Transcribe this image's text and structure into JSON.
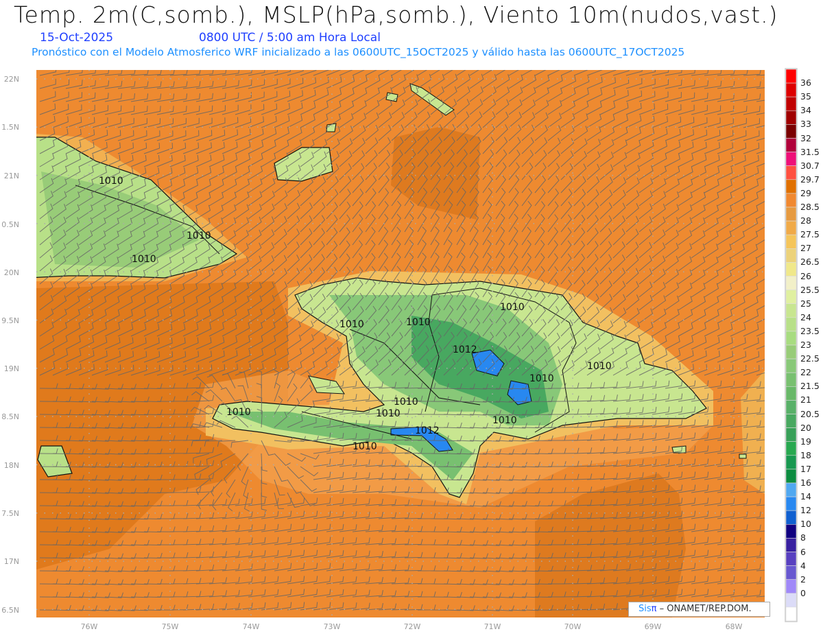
{
  "header": {
    "title": "Temp. 2m(C,somb.), MSLP(hPa,somb.), Viento 10m(nudos,vast.)",
    "date": "15-Oct-2025",
    "time": "0800 UTC / 5:00 am Hora Local",
    "description": "Pronóstico con el Modelo Atmosferico WRF inicializado a las 0600UTC_15OCT2025 y válido hasta las  0600UTC_17OCT2025"
  },
  "axes": {
    "x_labels": [
      "76W",
      "75W",
      "74W",
      "73W",
      "72W",
      "71W",
      "70W",
      "69W",
      "68W"
    ],
    "y_labels": [
      "22N",
      "1.5N",
      "21N",
      "0.5N",
      "20N",
      "9.5N",
      "19N",
      "8.5N",
      "18N",
      "7.5N",
      "17N",
      "6.5N"
    ]
  },
  "contour_labels": [
    "1010",
    "1010",
    "1010",
    "1010",
    "1010",
    "1010",
    "1010",
    "1012",
    "1010",
    "1010",
    "1010",
    "1010",
    "1010",
    "1012",
    "1010"
  ],
  "colorbar": {
    "labels": [
      "36",
      "35",
      "34",
      "33",
      "32",
      "31.5",
      "30.7",
      "29.7",
      "29",
      "28.5",
      "28",
      "27.5",
      "27",
      "26.5",
      "26",
      "25.5",
      "25",
      "24",
      "23.5",
      "23",
      "22.5",
      "22",
      "21.5",
      "21",
      "20.5",
      "20",
      "19",
      "18",
      "17",
      "16",
      "14",
      "12",
      "10",
      "8",
      "6",
      "4",
      "2",
      "0"
    ],
    "colors": [
      "#ff0000",
      "#dd0000",
      "#c00000",
      "#a00000",
      "#7a0000",
      "#b0003a",
      "#ee1078",
      "#ff5040",
      "#e07000",
      "#f08830",
      "#e69a40",
      "#f0aa48",
      "#f5c55a",
      "#ecd27a",
      "#f0e88a",
      "#f2f0c8",
      "#e0f0a0",
      "#c8e690",
      "#b8e088",
      "#a8dc80",
      "#98cc78",
      "#88c878",
      "#78c070",
      "#68b868",
      "#58b068",
      "#48a860",
      "#38a058",
      "#28a850",
      "#189850",
      "#0c8c40",
      "#50a8f0",
      "#2888f0",
      "#1060d0",
      "#100080",
      "#3820a0",
      "#5840c0",
      "#6858d0",
      "#a088f8",
      "#dcdcf8",
      "#ffffff"
    ]
  },
  "credit": {
    "sis": "Sis",
    "pi": "π",
    "text": " – ONAMET/REP.DOM."
  }
}
